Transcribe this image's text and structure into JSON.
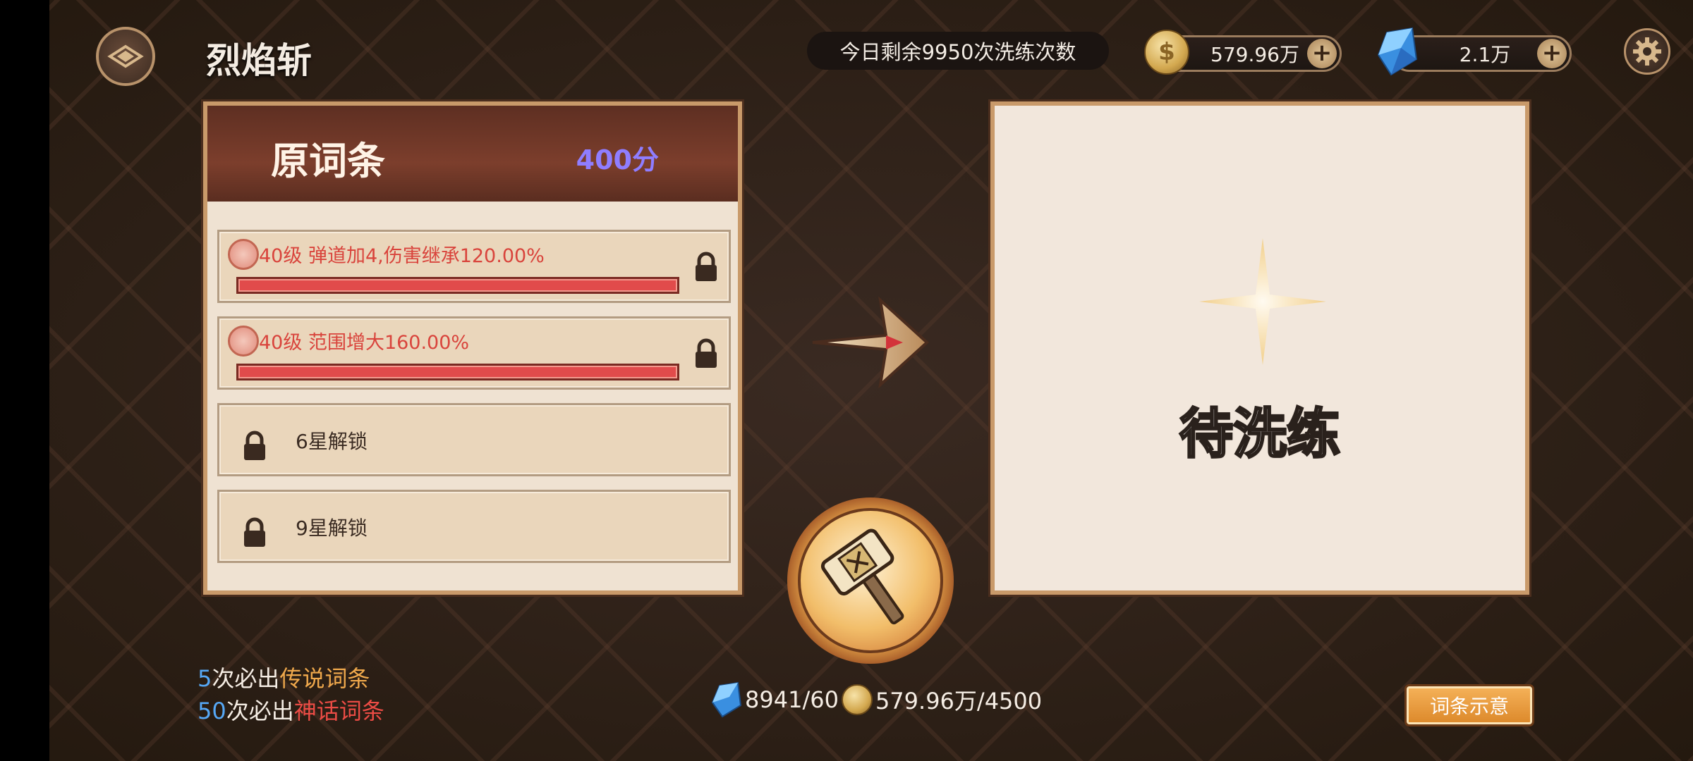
{
  "header": {
    "title": "烈焰斩",
    "daily_refine_text": "今日剩余9950次洗练次数",
    "coin_amount": "579.96万",
    "gem_amount": "2.1万",
    "plus_symbol": "+"
  },
  "original_affixes": {
    "title": "原词条",
    "score": "400分",
    "items": [
      {
        "text": "40级 弹道加4,伤害继承120.00%",
        "progress": 1.0,
        "locked": true
      },
      {
        "text": "40级 范围增大160.00%",
        "progress": 1.0,
        "locked": true
      },
      {
        "text": "6星解锁",
        "locked": true
      },
      {
        "text": "9星解锁",
        "locked": true
      }
    ]
  },
  "result_panel": {
    "pending_text": "待洗练"
  },
  "guarantee": {
    "line1_num": "5",
    "line1_mid": "次必出",
    "line1_tier": "传说词条",
    "line2_num": "50",
    "line2_mid": "次必出",
    "line2_tier": "神话词条"
  },
  "cost": {
    "gem_cost": "8941/60",
    "coin_cost": "579.96万/4500"
  },
  "buttons": {
    "affix_preview": "词条示意"
  },
  "icons": {
    "back": "back-icon",
    "coin": "coin-icon",
    "gem": "gem-icon",
    "settings": "gear-icon",
    "lock": "lock-icon",
    "hammer": "hammer-icon",
    "arrow": "arrow-right-icon",
    "sparkle": "sparkle-icon"
  },
  "colors": {
    "legend": "#f0a94c",
    "myth": "#ec4c45",
    "count": "#56a8f6",
    "score": "#8f7dff",
    "affix_text": "#d9443c"
  }
}
